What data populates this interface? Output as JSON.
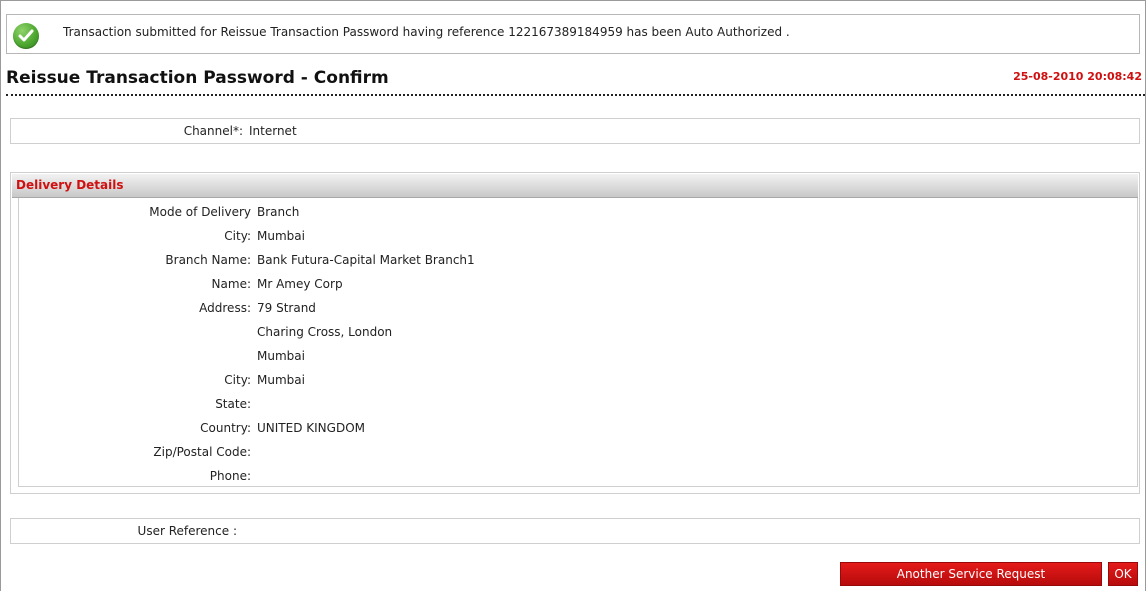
{
  "message": {
    "icon": "check-circle-icon",
    "text": "Transaction submitted for Reissue Transaction Password having reference 122167389184959 has been Auto Authorized ."
  },
  "header": {
    "title": "Reissue Transaction Password - Confirm",
    "timestamp": "25-08-2010 20:08:42"
  },
  "channel": {
    "label": "Channel*:",
    "value": "Internet"
  },
  "delivery": {
    "section_title": "Delivery Details",
    "rows": [
      {
        "label": "Mode of Delivery",
        "value": "Branch"
      },
      {
        "label": "City:",
        "value": "Mumbai"
      },
      {
        "label": "Branch Name:",
        "value": "Bank Futura-Capital Market Branch1"
      },
      {
        "label": "Name:",
        "value": "Mr Amey Corp"
      },
      {
        "label": "Address:",
        "value": "79 Strand"
      },
      {
        "label": "",
        "value": "Charing Cross, London"
      },
      {
        "label": "",
        "value": "Mumbai"
      },
      {
        "label": "City:",
        "value": "Mumbai"
      },
      {
        "label": "State:",
        "value": ""
      },
      {
        "label": "Country:",
        "value": "UNITED KINGDOM"
      },
      {
        "label": "Zip/Postal Code:",
        "value": ""
      },
      {
        "label": "Phone:",
        "value": ""
      }
    ]
  },
  "user_reference": {
    "label": "User Reference :",
    "value": ""
  },
  "buttons": {
    "another": "Another Service Request",
    "ok": "OK"
  },
  "colors": {
    "accent_red": "#d01010",
    "button_red": "#cc1111",
    "success_green": "#4ea831"
  }
}
